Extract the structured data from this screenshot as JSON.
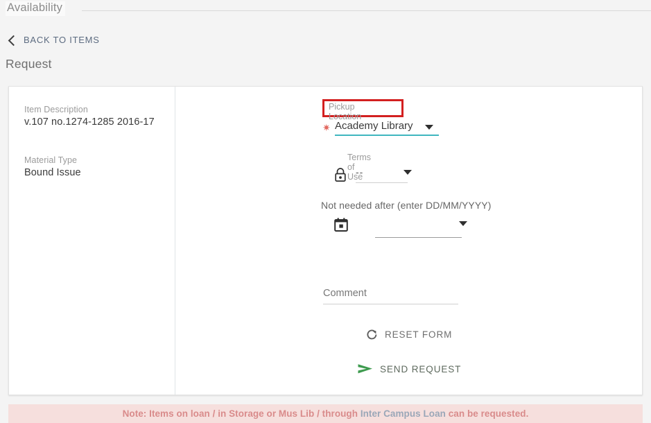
{
  "tab": {
    "label": "Availability"
  },
  "back_link": {
    "label": "BACK TO ITEMS",
    "icon": "chevron-left-icon"
  },
  "page_title": "Request",
  "item": {
    "description_label": "Item Description",
    "description_value": "v.107 no.1274-1285 2016-17",
    "material_label": "Material Type",
    "material_value": "Bound Issue"
  },
  "form": {
    "pickup": {
      "label": "Pickup Location",
      "value": "Academy Library",
      "required_marker": "✷",
      "caret_icon": "chevron-down-icon",
      "highlight_color": "#d32020",
      "underline_color": "#3fb6bf"
    },
    "terms": {
      "label": "Terms of Use",
      "value": "--",
      "icon": "lock-icon",
      "caret_icon": "chevron-down-icon"
    },
    "date": {
      "label": "Not needed after (enter DD/MM/YYYY)",
      "value": "",
      "placeholder": "",
      "icon": "calendar-icon",
      "caret_icon": "chevron-down-icon"
    },
    "comment": {
      "label": "Comment",
      "value": "",
      "placeholder": ""
    },
    "reset_button": {
      "label": "RESET FORM",
      "icon": "refresh-icon"
    },
    "send_button": {
      "label": "SEND REQUEST",
      "icon": "send-arrow-icon",
      "color": "#3e9b4f"
    }
  },
  "footer": {
    "text_before": "Note: Items on loan / in Storage or Mus Lib / through ",
    "link_text": "Inter Campus Loan",
    "text_after": " can be requested.",
    "background": "#f6dfdd",
    "text_color": "#d98b8b",
    "link_color": "#9aa7b8"
  }
}
